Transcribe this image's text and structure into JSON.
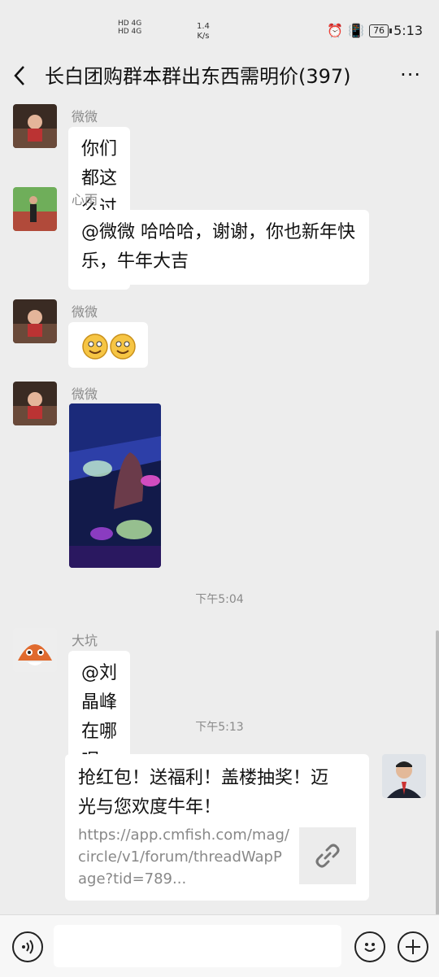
{
  "status_bar": {
    "network_top": "HD 4G",
    "network_bottom": "HD 4G",
    "speed_value": "1.4",
    "speed_unit": "K/s",
    "battery": "76",
    "time": "5:13"
  },
  "header": {
    "title": "长白团购群本群出东西需明价(397)",
    "more": "···"
  },
  "messages": [
    {
      "sender": "微微",
      "text": "你们都这么过年的？"
    },
    {
      "sender": "心雨",
      "text": "@微微  哈哈哈，谢谢，你也新年快乐，牛年大吉"
    },
    {
      "sender": "微微",
      "text": ""
    },
    {
      "sender": "微微",
      "text": ""
    },
    {
      "time": "下午5:04"
    },
    {
      "sender": "大坑",
      "text": "@刘晶峰  在哪呢啊？"
    },
    {
      "time": "下午5:13"
    },
    {
      "card_title": "抢红包！送福利！盖楼抽奖！迈光与您欢度牛年！",
      "card_url": "https://app.cmfish.com/mag/circle/v1/forum/threadWapPage?tid=789..."
    }
  ],
  "colors": {
    "chat_background": "#ededed",
    "bubble": "#ffffff",
    "secondary_text": "#8a8a8a"
  }
}
